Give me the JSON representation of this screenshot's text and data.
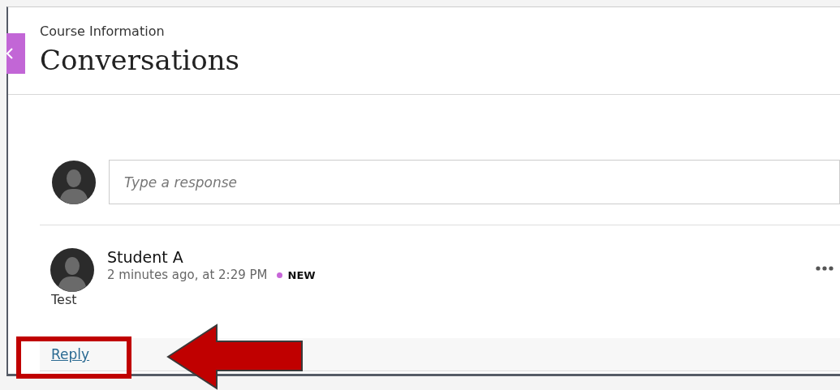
{
  "header": {
    "breadcrumb": "Course Information",
    "title": "Conversations"
  },
  "composer": {
    "placeholder": "Type a response"
  },
  "posts": [
    {
      "author": "Student A",
      "time": "2 minutes ago, at 2:29 PM",
      "is_new": true,
      "new_label": "NEW",
      "body": "Test",
      "reply_label": "Reply"
    }
  ]
}
